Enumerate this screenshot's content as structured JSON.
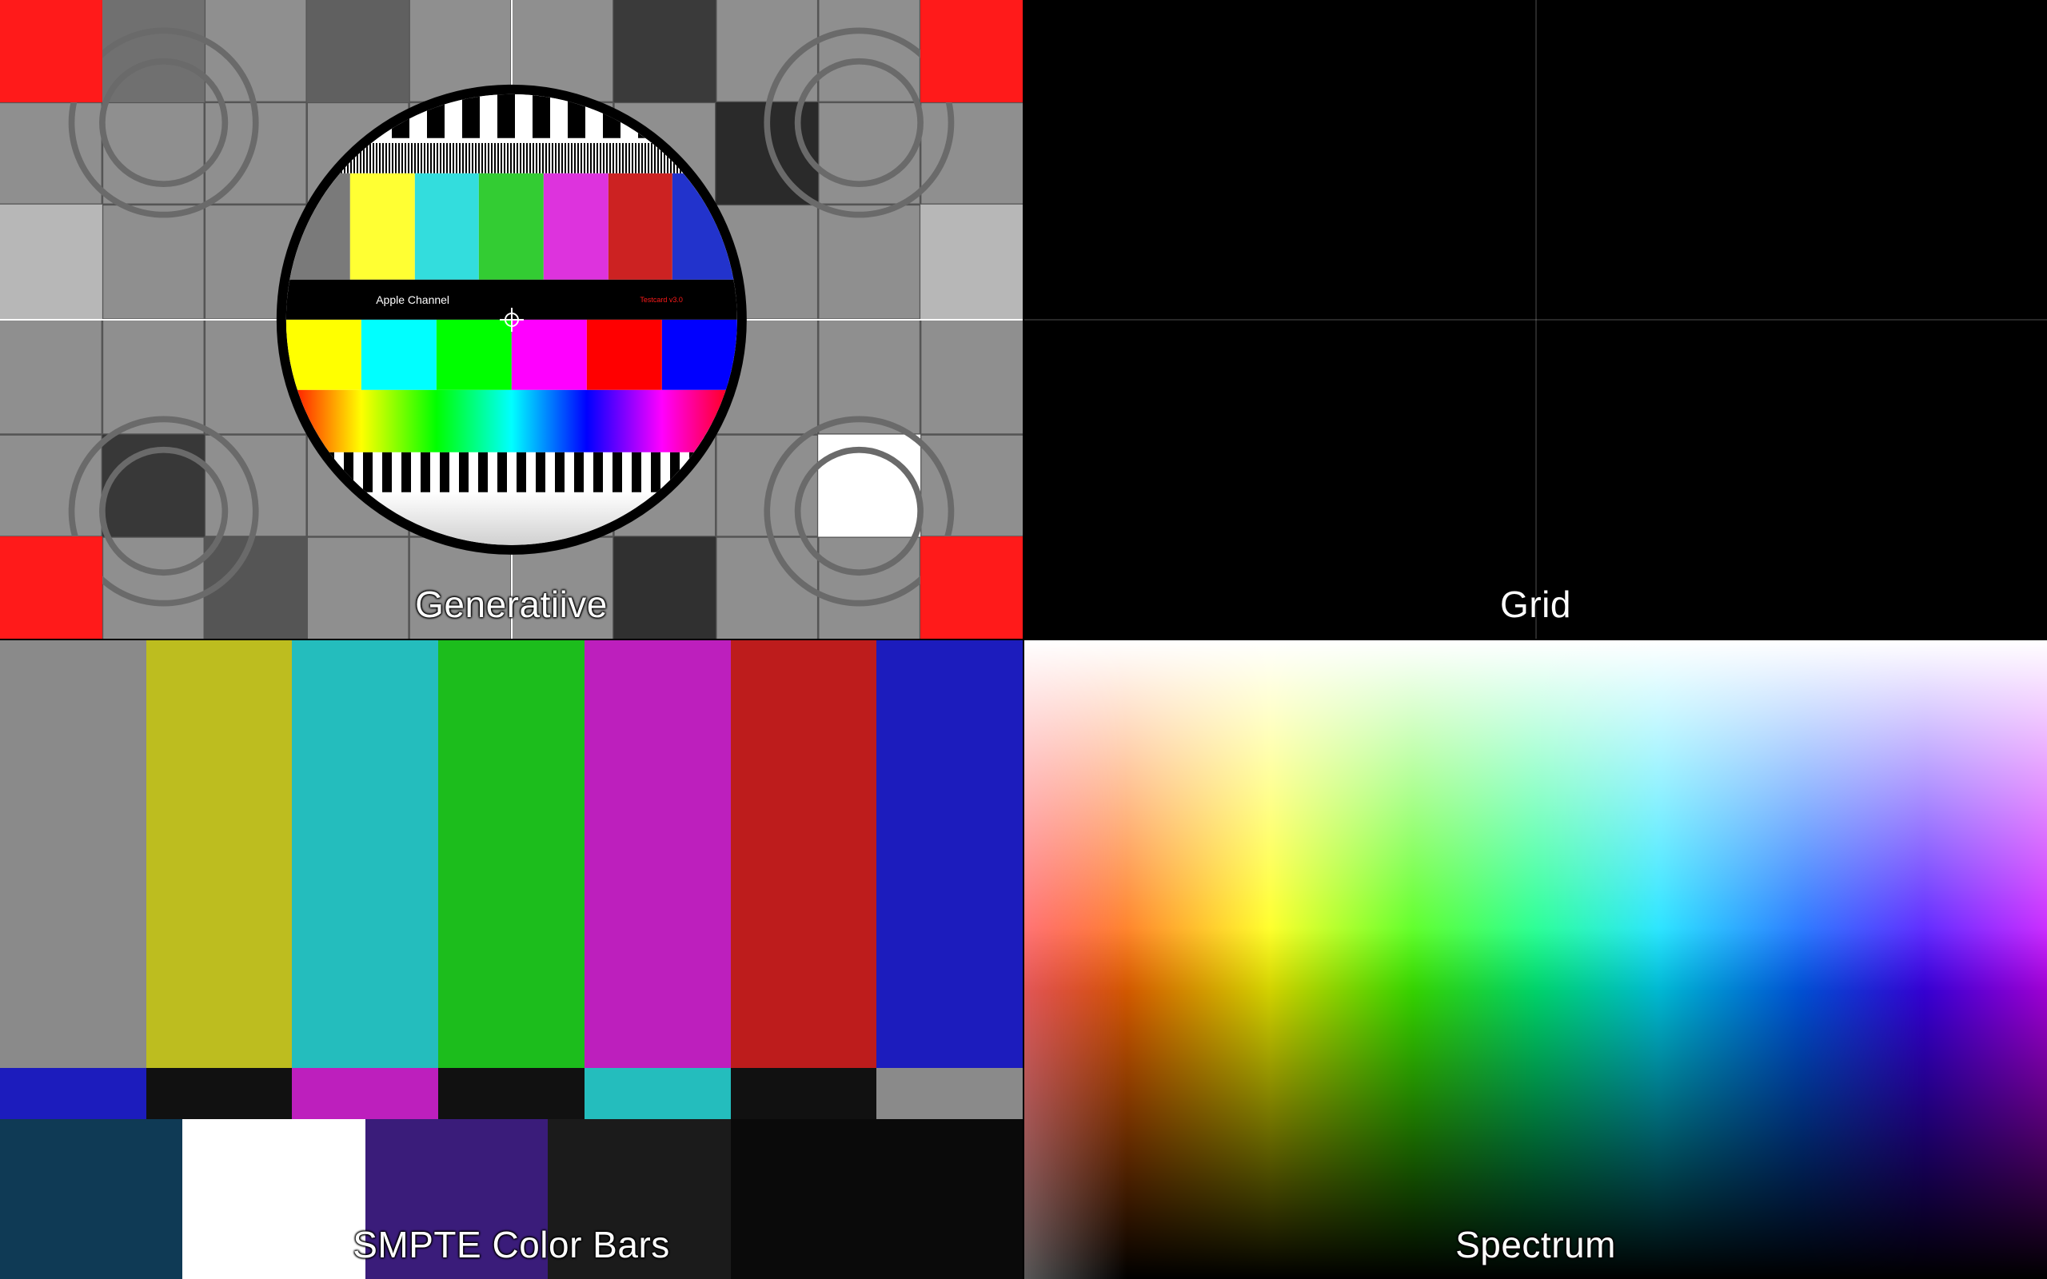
{
  "tiles": {
    "generative": {
      "label": "Generatiive",
      "channel_text": "Apple Channel",
      "version_text": "Testcard v3.0",
      "corner_color": "#ff1a1a",
      "upper_bars": [
        "grey",
        "yellow",
        "cyan",
        "green",
        "magenta",
        "red",
        "blue"
      ],
      "lower_bars": [
        "yellow",
        "cyan",
        "green",
        "magenta",
        "red",
        "blue"
      ]
    },
    "grid": {
      "label": "Grid"
    },
    "smpte": {
      "label": "SMPTE Color Bars",
      "top": [
        "grey",
        "yellow",
        "cyan",
        "green",
        "magenta",
        "red",
        "blue"
      ],
      "mid": [
        "blue",
        "black",
        "magenta",
        "black",
        "cyan",
        "black",
        "grey"
      ],
      "bottom": [
        "-I/navy",
        "white",
        "+Q/purple",
        "black",
        "super-black"
      ]
    },
    "spectrum": {
      "label": "Spectrum"
    }
  }
}
